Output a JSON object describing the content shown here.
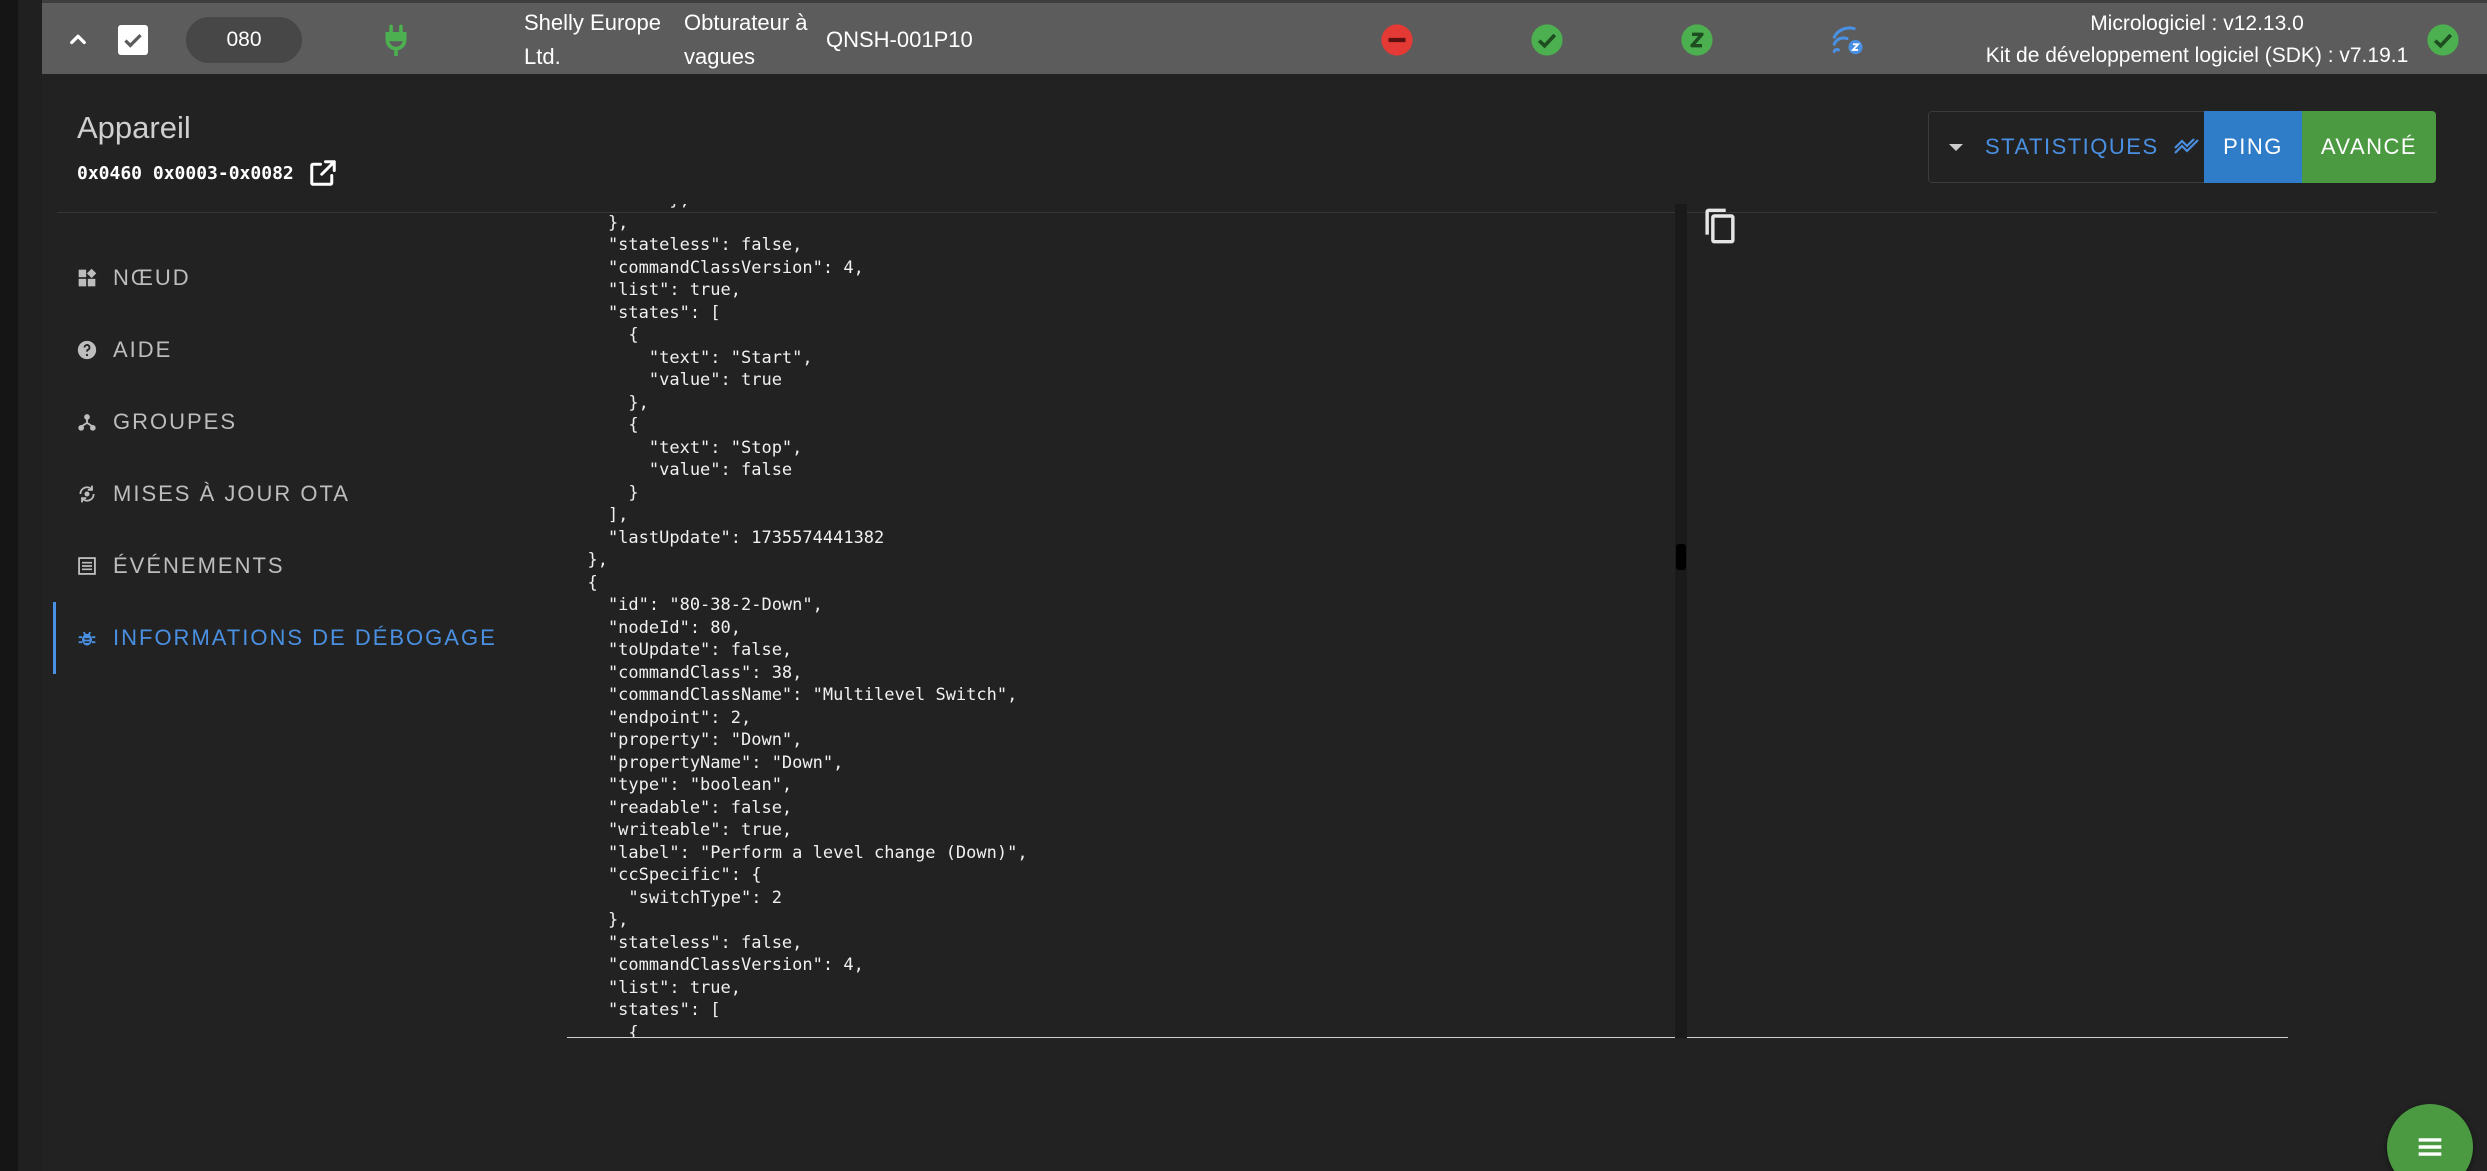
{
  "node_row": {
    "node_id": "080",
    "manufacturer_line1": "Shelly Europe",
    "manufacturer_line2": "Ltd.",
    "product_line1": "Obturateur à",
    "product_line2": "vagues",
    "model": "QNSH-001P10",
    "firmware": "Micrologiciel : v12.13.0",
    "sdk": "Kit de développement logiciel (SDK) : v7.19.1",
    "colors": {
      "red": "#e53935",
      "green": "#4caf50",
      "blue": "#4a90e2"
    }
  },
  "device": {
    "title": "Appareil",
    "id": "0x0460 0x0003-0x0082"
  },
  "actions": {
    "stats_label": "STATISTIQUES",
    "ping_label": "PING",
    "advanced_label": "AVANCÉ"
  },
  "sidebar": {
    "items": [
      {
        "label": "NŒUD",
        "icon": "widgets-icon"
      },
      {
        "label": "AIDE",
        "icon": "help-icon"
      },
      {
        "label": "GROUPES",
        "icon": "groups-icon"
      },
      {
        "label": "MISES À JOUR OTA",
        "icon": "ota-update-icon"
      },
      {
        "label": "ÉVÉNEMENTS",
        "icon": "events-list-icon"
      },
      {
        "label": "INFORMATIONS DE DÉBOGAGE",
        "icon": "bug-icon"
      }
    ]
  },
  "debug_code": "          },\n    },\n    \"stateless\": false,\n    \"commandClassVersion\": 4,\n    \"list\": true,\n    \"states\": [\n      {\n        \"text\": \"Start\",\n        \"value\": true\n      },\n      {\n        \"text\": \"Stop\",\n        \"value\": false\n      }\n    ],\n    \"lastUpdate\": 1735574441382\n  },\n  {\n    \"id\": \"80-38-2-Down\",\n    \"nodeId\": 80,\n    \"toUpdate\": false,\n    \"commandClass\": 38,\n    \"commandClassName\": \"Multilevel Switch\",\n    \"endpoint\": 2,\n    \"property\": \"Down\",\n    \"propertyName\": \"Down\",\n    \"type\": \"boolean\",\n    \"readable\": false,\n    \"writeable\": true,\n    \"label\": \"Perform a level change (Down)\",\n    \"ccSpecific\": {\n      \"switchType\": 2\n    },\n    \"stateless\": false,\n    \"commandClassVersion\": 4,\n    \"list\": true,\n    \"states\": [\n      {"
}
